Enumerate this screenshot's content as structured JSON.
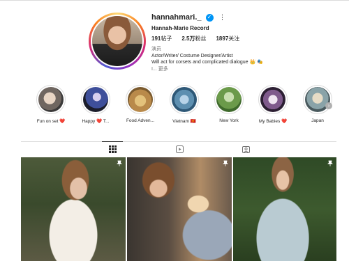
{
  "profile": {
    "username": "hannahmari._",
    "full_name": "Hannah-Marie Record",
    "stats": [
      {
        "value": "191",
        "label": "帖子"
      },
      {
        "value": "2.5万",
        "label": "粉丝"
      },
      {
        "value": "1897",
        "label": "关注"
      }
    ],
    "bio_category": "演员",
    "bio_line1": "Actor/Writer/ Costume Designer/Artist",
    "bio_line2": "Will act for corsets and complicated dialogue 👑 🎭",
    "bio_line3": "I... 更多",
    "more_icon": "more-horizontal-icon",
    "verified_color": "#0095f6"
  },
  "highlights": [
    {
      "label": "Fun on set ❤️"
    },
    {
      "label": "Happy ❤️ T..."
    },
    {
      "label": "Food Adven..."
    },
    {
      "label": "Vietnam 🇻🇳"
    },
    {
      "label": "New York"
    },
    {
      "label": "My Babies ❤️"
    },
    {
      "label": "Japan"
    }
  ],
  "tabs": [
    {
      "icon": "grid-icon",
      "active": true
    },
    {
      "icon": "reels-icon",
      "active": false
    },
    {
      "icon": "tagged-icon",
      "active": false
    }
  ],
  "posts": [
    {
      "pinned": true
    },
    {
      "pinned": true
    },
    {
      "pinned": true
    }
  ]
}
